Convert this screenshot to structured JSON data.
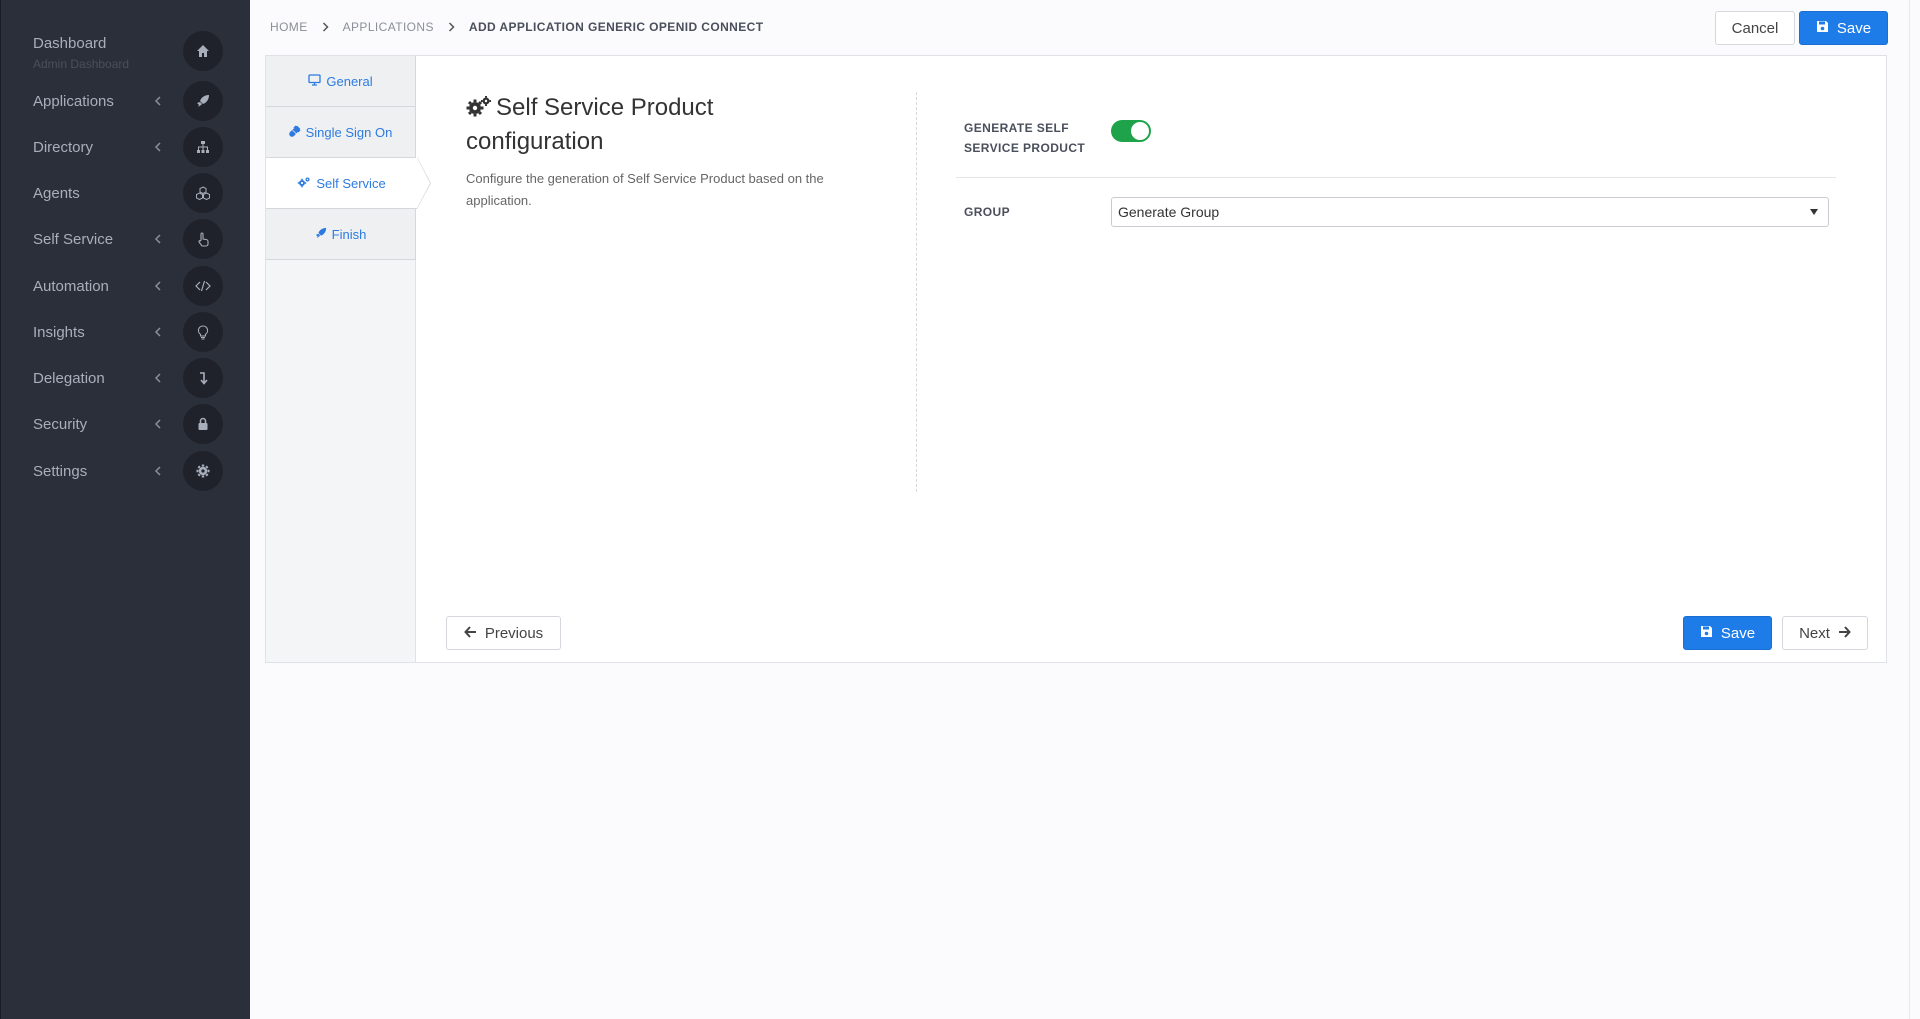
{
  "sidebar": {
    "items": [
      {
        "label": "Dashboard",
        "sub": "Admin Dashboard",
        "icon": "home-icon",
        "chevron": false
      },
      {
        "label": "Applications",
        "icon": "rocket-icon",
        "chevron": true
      },
      {
        "label": "Directory",
        "icon": "sitemap-icon",
        "chevron": true
      },
      {
        "label": "Agents",
        "icon": "cubes-icon",
        "chevron": false
      },
      {
        "label": "Self Service",
        "icon": "hand-pointer-icon",
        "chevron": true
      },
      {
        "label": "Automation",
        "icon": "code-icon",
        "chevron": true
      },
      {
        "label": "Insights",
        "icon": "lightbulb-icon",
        "chevron": true
      },
      {
        "label": "Delegation",
        "icon": "level-down-icon",
        "chevron": true
      },
      {
        "label": "Security",
        "icon": "lock-icon",
        "chevron": true
      },
      {
        "label": "Settings",
        "icon": "gear-icon",
        "chevron": true
      }
    ]
  },
  "breadcrumb": {
    "home": "HOME",
    "applications": "APPLICATIONS",
    "current": "ADD APPLICATION GENERIC OPENID CONNECT"
  },
  "toolbar": {
    "cancel_label": "Cancel",
    "save_label": "Save"
  },
  "tabs": [
    {
      "label": "General",
      "icon": "desktop-icon"
    },
    {
      "label": "Single Sign On",
      "icon": "plug-icon"
    },
    {
      "label": "Self Service",
      "icon": "gears-icon",
      "active": true
    },
    {
      "label": "Finish",
      "icon": "rocket-icon"
    }
  ],
  "section": {
    "title": "Self Service Product configuration",
    "description": "Configure the generation of Self Service Product based on the application."
  },
  "form": {
    "generate_label": "GENERATE SELF SERVICE PRODUCT",
    "generate_on": true,
    "group_label": "GROUP",
    "group_value": "Generate Group"
  },
  "footer": {
    "previous_label": "Previous",
    "save_label": "Save",
    "next_label": "Next"
  },
  "colors": {
    "sidebar_bg": "#2b2f3a",
    "primary": "#1e7ce8",
    "toggle_on": "#1ea34b",
    "tab_text": "#2d7be0"
  }
}
